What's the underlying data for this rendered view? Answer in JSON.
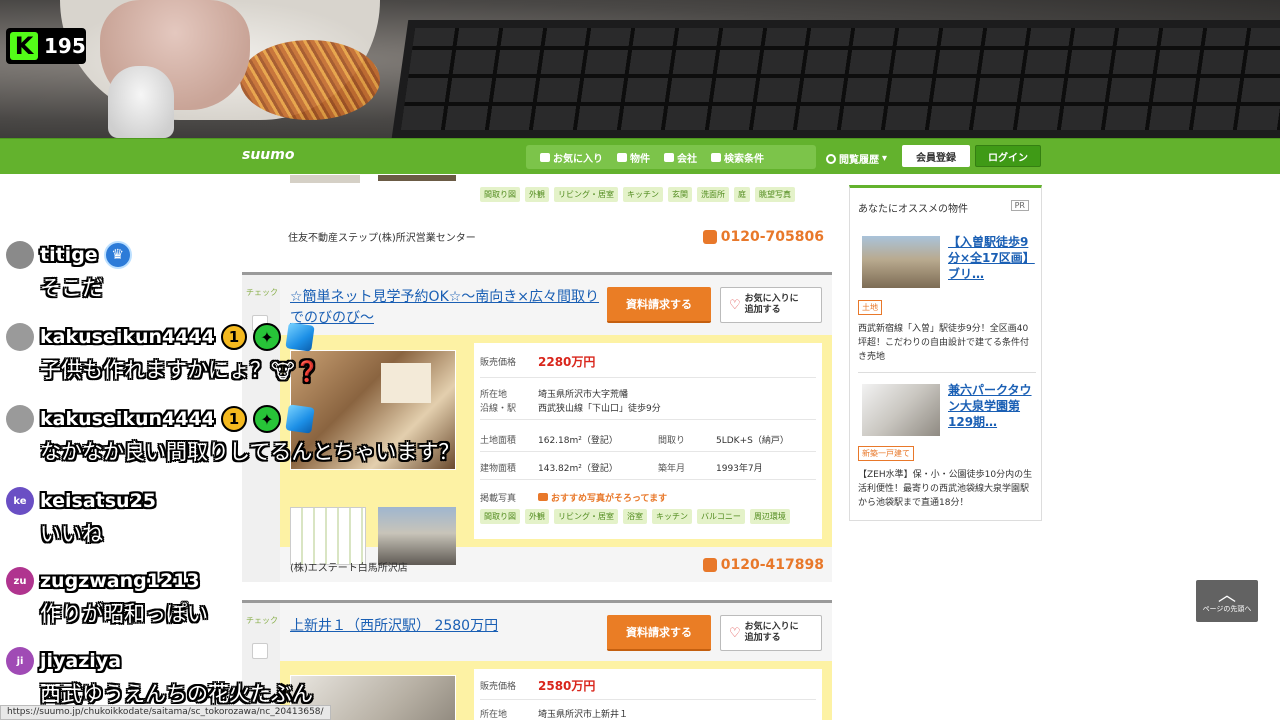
{
  "overlay": {
    "viewer_count": "195",
    "logo_letter": "K"
  },
  "header": {
    "logo": "suumo",
    "nav": [
      {
        "label": "お気に入り",
        "icon": "checkbox-icon"
      },
      {
        "label": "物件",
        "icon": "house-icon"
      },
      {
        "label": "会社",
        "icon": "building-icon"
      },
      {
        "label": "検索条件",
        "icon": "search-icon"
      }
    ],
    "history_label": "閲覧履歴",
    "register_label": "会員登録",
    "login_label": "ログイン"
  },
  "listing1": {
    "tags": [
      "間取り図",
      "外観",
      "リビング・居室",
      "キッチン",
      "玄関",
      "洗面所",
      "庭",
      "眺望写真"
    ],
    "company": "住友不動産ステップ(株)所沢営業センター",
    "phone": "0120-705806"
  },
  "listing2": {
    "check_label": "チェック",
    "title": "☆簡単ネット見学予約OK☆～南向き×広々間取りでのびのび～",
    "request_button": "資料請求する",
    "fav_button_line1": "お気に入りに",
    "fav_button_line2": "追加する",
    "price_label": "販売価格",
    "price": "2280万円",
    "address_label": "所在地",
    "address": "埼玉県所沢市大字荒幡",
    "station_label": "沿線・駅",
    "station": "西武狭山線「下山口」徒歩9分",
    "land_label": "土地面積",
    "land": "162.18m²（登記）",
    "layout_label": "間取り",
    "layout": "5LDK+S（納戸）",
    "building_label": "建物面積",
    "building": "143.82m²（登記）",
    "built_label": "築年月",
    "built": "1993年7月",
    "photos_label": "掲載写真",
    "photos_note": "おすすめ写真がそろってます",
    "tags": [
      "間取り図",
      "外観",
      "リビング・居室",
      "浴室",
      "キッチン",
      "バルコニー",
      "周辺環境"
    ],
    "company": "(株)エステート白馬所沢店",
    "phone": "0120-417898"
  },
  "listing3": {
    "check_label": "チェック",
    "title": "上新井１（西所沢駅） 2580万円",
    "request_button": "資料請求する",
    "fav_button_line1": "お気に入りに",
    "fav_button_line2": "追加する",
    "price_label": "販売価格",
    "price": "2580万円",
    "address_label": "所在地",
    "address": "埼玉県所沢市上新井１"
  },
  "recommend": {
    "heading": "あなたにオススメの物件",
    "pr": "PR",
    "items": [
      {
        "title": "【入曽駅徒歩9分×全17区画】ブリ…",
        "badge": "土地",
        "desc": "西武新宿線「入曽」駅徒歩9分！全区画40坪超！こだわりの自由設計で建てる条件付き売地"
      },
      {
        "title": "兼六パークタウン大泉学園第129期…",
        "badge": "新築一戸建て",
        "desc": "【ZEH水準】保・小・公園徒歩10分内の生活利便性！最寄りの西武池袋線大泉学園駅から池袋駅まで直通18分！"
      }
    ]
  },
  "pagetop": {
    "label": "ページの先頭へ"
  },
  "chat": [
    {
      "user": "titige",
      "avatar_color": "#8a8a8a",
      "avatar_text": "",
      "badges": [
        "crown"
      ],
      "text": "そこだ"
    },
    {
      "user": "kakuseikun4444",
      "avatar_color": "#9a9a9a",
      "avatar_text": "",
      "badges": [
        "one",
        "star",
        "cube"
      ],
      "text": "子供も作れますかにょ？",
      "emotes": [
        "🐮",
        "❓"
      ]
    },
    {
      "user": "kakuseikun4444",
      "avatar_color": "#9a9a9a",
      "avatar_text": "",
      "badges": [
        "one",
        "star",
        "cube"
      ],
      "text": "なかなか良い間取りしてるんとちゃいます？"
    },
    {
      "user": "keisatsu25",
      "avatar_color": "#6a4fc4",
      "avatar_text": "ke",
      "badges": [],
      "text": "いいね"
    },
    {
      "user": "zugzwang1213",
      "avatar_color": "#b0348f",
      "avatar_text": "zu",
      "badges": [],
      "text": "作りが昭和っぽい"
    },
    {
      "user": "jiyaziya",
      "avatar_color": "#a04bb5",
      "avatar_text": "ji",
      "badges": [],
      "text": "西武ゆうえんちの花火たぶん"
    }
  ],
  "status_url": "https://suumo.jp/chukoikkodate/saitama/sc_tokorozawa/nc_20413658/"
}
